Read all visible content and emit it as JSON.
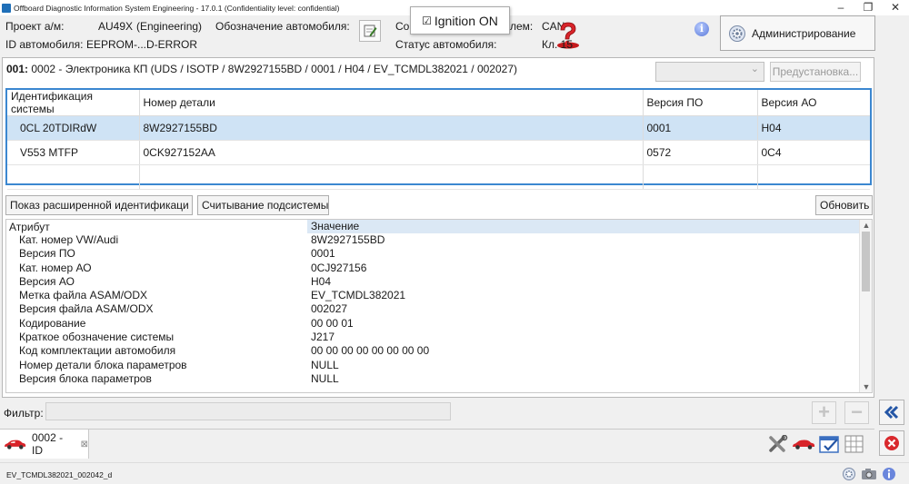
{
  "window": {
    "title": "Offboard Diagnostic Information System Engineering - 17.0.1 (Confidentiality level: confidential)",
    "controls": {
      "minimize": "–",
      "restore": "❐",
      "close": "✕"
    }
  },
  "header": {
    "project_label": "Проект а/м:",
    "project_code": "AU49X",
    "project_mode": "(Engineering)",
    "vehicle_designation_label": "Обозначение автомобиля:",
    "vehicle_id_label": "ID автомобиля:",
    "vehicle_id_value": "EEPROM-...D-ERROR",
    "comm_label_start": "Со",
    "comm_label_end": "лем:",
    "comm_value": "CAN",
    "vehicle_status_label": "Статус автомобиля:",
    "vehicle_status_value": "Кл. 15",
    "ignition_popup": {
      "checkbox": "☑",
      "label": "Ignition ON"
    },
    "admin_button": "Администрирование",
    "info_icon": "i"
  },
  "control_unit": {
    "number": "001:",
    "description": "0002 - Электроника КП  (UDS / ISOTP / 8W2927155BD / 0001 / H04 / EV_TCMDL382021 / 002027)",
    "preset_button": "Предустановка..."
  },
  "ident_table": {
    "columns": [
      "Идентификация системы",
      "Номер детали",
      "Версия ПО",
      "Версия АО"
    ],
    "rows": [
      [
        "0CL 20TDIRdW",
        "8W2927155BD",
        "0001",
        "H04"
      ],
      [
        "V553 MTFP",
        "0CK927152AA",
        "0572",
        "0C4"
      ],
      [
        "",
        "",
        "",
        ""
      ]
    ]
  },
  "buttons": {
    "extended_ident": "Показ расширенной идентификаци",
    "read_subsystem": "Считывание подсистемы",
    "refresh": "Обновить"
  },
  "attributes": {
    "header_attr": "Атрибут",
    "header_value": "Значение",
    "rows": [
      [
        "Кат. номер VW/Audi",
        "8W2927155BD"
      ],
      [
        "Версия ПО",
        "0001"
      ],
      [
        "Кат. номер АО",
        "0CJ927156"
      ],
      [
        "Версия АО",
        "H04"
      ],
      [
        "Метка файла ASAM/ODX",
        "EV_TCMDL382021"
      ],
      [
        "Версия файла ASAM/ODX",
        "002027"
      ],
      [
        "Кодирование",
        "00 00 01"
      ],
      [
        "Краткое обозначение системы",
        "J217"
      ],
      [
        "Код комплектации автомобиля",
        "00 00 00 00 00 00 00 00"
      ],
      [
        "Номер детали блока параметров",
        "NULL"
      ],
      [
        "Версия блока параметров",
        "NULL"
      ]
    ]
  },
  "filter": {
    "label": "Фильтр:",
    "value": "",
    "add": "+",
    "remove": "−"
  },
  "tabs": [
    {
      "label": "0002 - ID",
      "close": "⊠"
    }
  ],
  "statusbar": {
    "text": "EV_TCMDL382021_002042_d"
  },
  "colors": {
    "selection": "#cfe3f5",
    "accent": "#3b87d0",
    "car": "#d8242a"
  }
}
